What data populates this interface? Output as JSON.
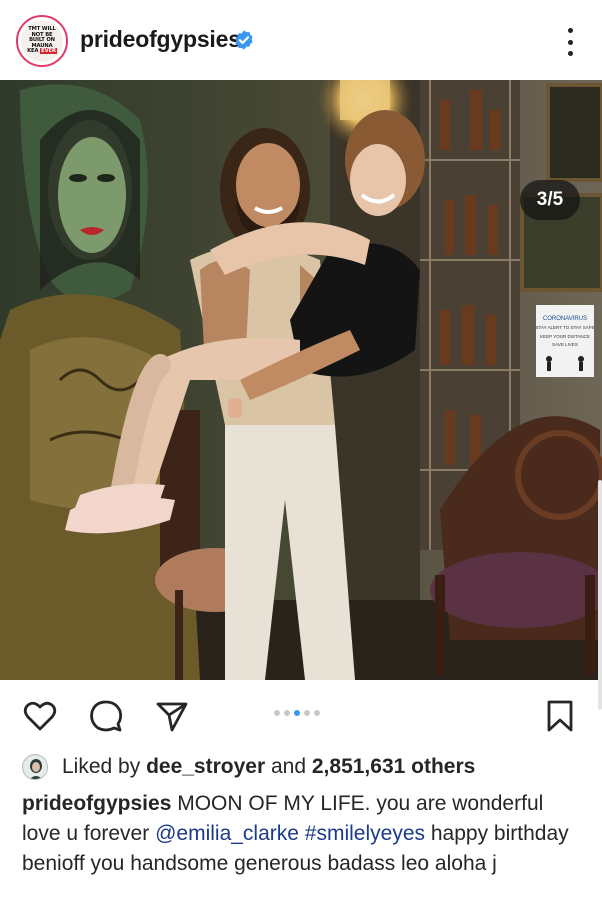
{
  "header": {
    "avatar_text": [
      "TMT WILL",
      "NOT BE",
      "BUILT ON",
      "MAUNA",
      "KEA",
      "EVER"
    ],
    "username": "prideofgypsies",
    "verified": true,
    "more_icon": "more-vertical-icon"
  },
  "photo": {
    "counter": "3/5",
    "sign_lines": [
      "CORONAVIRUS",
      "STAY ALERT TO STAY SAFE",
      "KEEP YOUR DISTANCE",
      "SAVE LIVES"
    ]
  },
  "actions": {
    "icons": [
      "heart-icon",
      "comment-icon",
      "share-icon",
      "bookmark-icon"
    ],
    "pagination": {
      "total": 5,
      "active": 3
    }
  },
  "likes": {
    "prefix": "Liked by",
    "user": "dee_stroyer",
    "middle": "and",
    "count": "2,851,631 others"
  },
  "caption": {
    "username": "prideofgypsies",
    "text_1": "MOON OF MY LIFE. you are wonderful love u forever",
    "mention": "@emilia_clarke",
    "hashtag": "#smilelyeyes",
    "text_2": "happy birthday benioff you handsome generous badass leo aloha j"
  },
  "colors": {
    "accent": "#3897f0",
    "verified": "#3897f0",
    "link": "#1b3a8c",
    "text": "#262626"
  }
}
